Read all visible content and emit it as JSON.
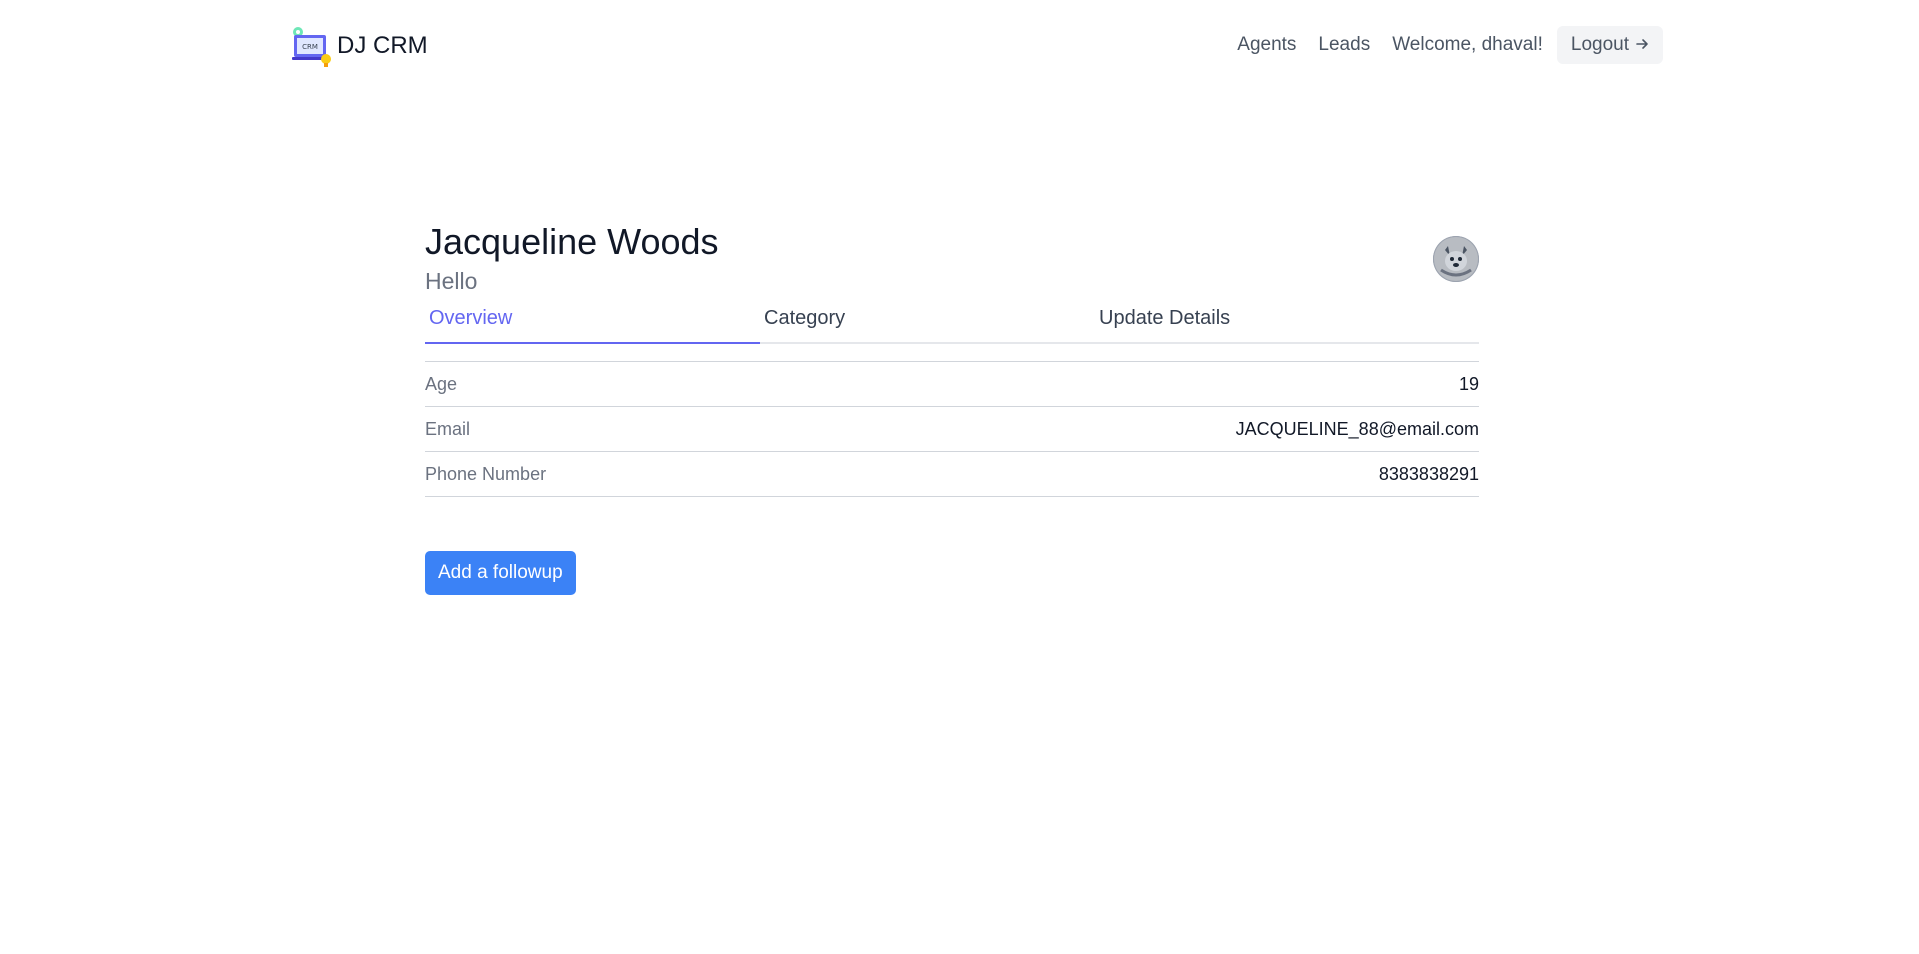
{
  "brand": {
    "name": "DJ CRM",
    "logo_text": "CRM"
  },
  "nav": {
    "agents": "Agents",
    "leads": "Leads",
    "welcome": "Welcome, dhaval!",
    "logout": "Logout",
    "logout_icon": "arrow-right-icon"
  },
  "lead": {
    "name": "Jacqueline Woods",
    "description": "Hello"
  },
  "tabs": [
    {
      "label": "Overview",
      "active": true
    },
    {
      "label": "Category",
      "active": false
    },
    {
      "label": "Update Details",
      "active": false
    }
  ],
  "details": [
    {
      "label": "Age",
      "value": "19"
    },
    {
      "label": "Email",
      "value": "JACQUELINE_88@email.com"
    },
    {
      "label": "Phone Number",
      "value": "8383838291"
    }
  ],
  "actions": {
    "add_followup": "Add a followup"
  },
  "colors": {
    "accent": "#6366f1",
    "primary_button": "#3b82f6",
    "muted_text": "#6b7280"
  }
}
